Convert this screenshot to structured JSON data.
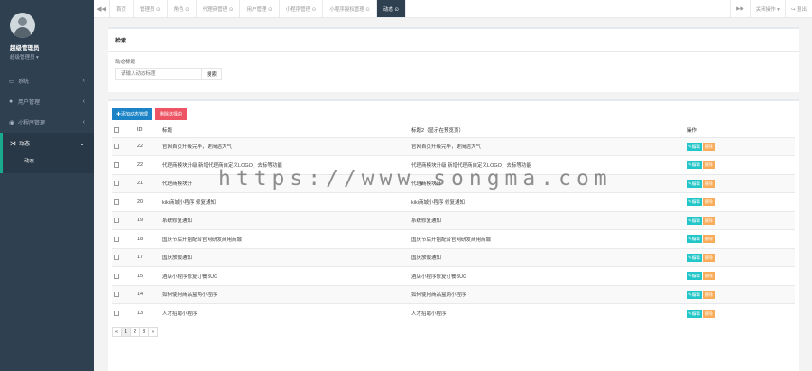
{
  "sidebar": {
    "user_name": "超级管理员",
    "user_role": "超级管理员 ▾",
    "items": [
      {
        "label": "系统",
        "icon": "desktop-icon"
      },
      {
        "label": "用户管理",
        "icon": "user-icon"
      },
      {
        "label": "小程序管理",
        "icon": "wechat-icon"
      },
      {
        "label": "动态",
        "icon": "share-icon"
      }
    ],
    "sub_item": "动态"
  },
  "topbar": {
    "back": "◀◀",
    "tabs": [
      "首页",
      "管理员 ⊙",
      "角色 ⊙",
      "代理商管理 ⊙",
      "用户管理 ⊙",
      "小程序管理 ⊙",
      "小程序授权管理 ⊙",
      "动态 ⊙"
    ],
    "forward": "▶▶",
    "close_ops": "关闭操作 ▾",
    "logout": "↪ 退出"
  },
  "search": {
    "title": "检索",
    "label": "动态标题",
    "placeholder": "请输入动态标题",
    "button": "搜索"
  },
  "list": {
    "add_button": "✚添加动态管理",
    "delete_button": "删除选择的",
    "columns": [
      "ID",
      "标题",
      "标题2（显示在预览页）",
      "操作"
    ],
    "edit_label": "✎编辑",
    "delete_label": "删除",
    "rows": [
      {
        "id": "22",
        "title": "官网首页升级完毕，更简洁大气",
        "title2": "官网首页升级完毕，更简洁大气"
      },
      {
        "id": "22",
        "title": "代理商模块升级 新增代理商自定义LOGO，去标等功能",
        "title2": "代理商模块升级 新增代理商自定义LOGO，去标等功能"
      },
      {
        "id": "21",
        "title": "代理商模块升",
        "title2": "代理商模块升"
      },
      {
        "id": "20",
        "title": "kiki商城小程序 修复通知",
        "title2": "kiki商城小程序 修复通知"
      },
      {
        "id": "19",
        "title": "系统修复通知",
        "title2": "系统修复通知"
      },
      {
        "id": "18",
        "title": "国庆节后开始配合官网研发商用商城",
        "title2": "国庆节后开始配合官网研发商用商城"
      },
      {
        "id": "17",
        "title": "国庆放假通知",
        "title2": "国庆放假通知"
      },
      {
        "id": "15",
        "title": "酒店小程序修复订餐BUG",
        "title2": "酒店小程序修复订餐BUG"
      },
      {
        "id": "14",
        "title": "如何使用商品盒两小程序",
        "title2": "如何使用商品盒两小程序"
      },
      {
        "id": "13",
        "title": "人才招聘小程序",
        "title2": "人才招聘小程序"
      }
    ],
    "pager": [
      "«",
      "1",
      "2",
      "3",
      "»"
    ]
  },
  "watermark": "https://www.songma.com"
}
